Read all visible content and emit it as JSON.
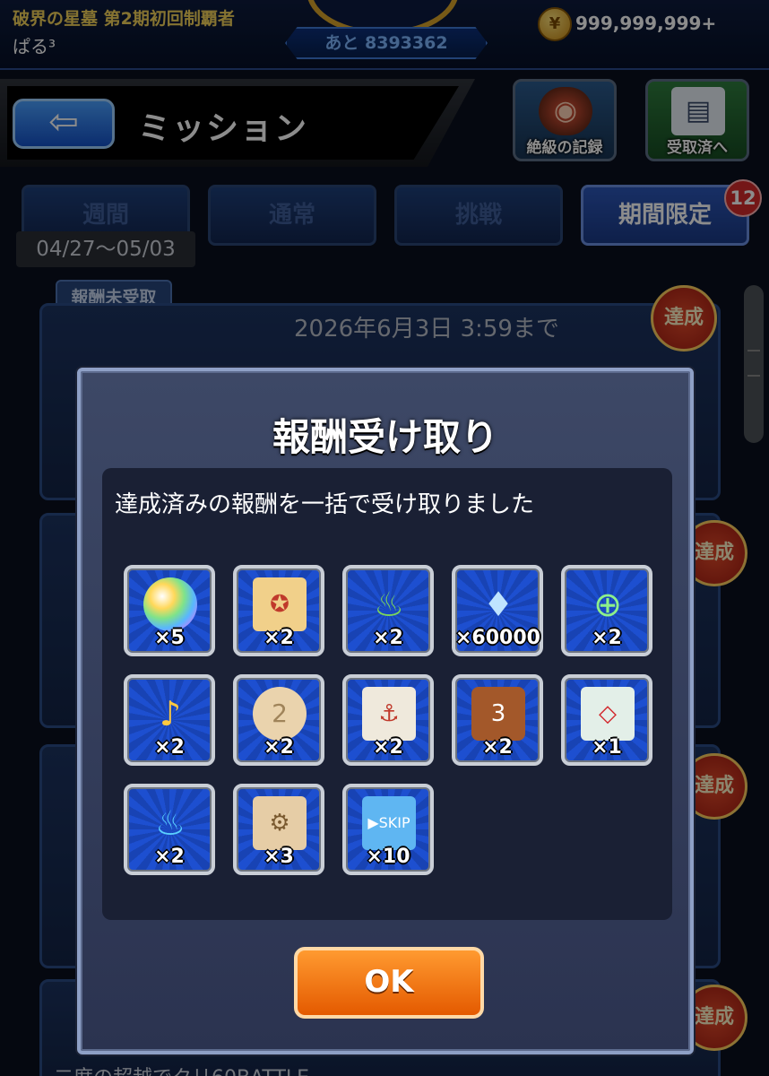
{
  "header": {
    "title": "破界の星墓 第2期初回制覇者",
    "player_name": "ぱる³",
    "remaining": "あと 8393362",
    "coin_count": "999,999,999+"
  },
  "mission": {
    "back_label": "⇦",
    "title": "ミッション",
    "record_label": "絶級の記録",
    "received_label": "受取済へ"
  },
  "tabs": [
    {
      "label": "週間"
    },
    {
      "label": "通常"
    },
    {
      "label": "挑戦"
    },
    {
      "label": "期間限定"
    }
  ],
  "tab_badge": "12",
  "date_range": "04/27〜05/03",
  "list": {
    "unreceived_tag": "報酬未受取",
    "deadline": "2026年6月3日 3:59まで",
    "stamp": "達成",
    "bottom_text": "二度の超越でクリ60BATTLE..."
  },
  "dialog": {
    "title": "報酬受け取り",
    "message": "達成済みの報酬を一括で受け取りました",
    "ok_label": "OK",
    "rewards": [
      {
        "icon": "rainbow-orb",
        "qty": "×5"
      },
      {
        "icon": "scroll-red",
        "qty": "×2"
      },
      {
        "icon": "potion-green",
        "qty": "×2"
      },
      {
        "icon": "blue-flame",
        "qty": "×60000"
      },
      {
        "icon": "magnifier",
        "qty": "×2"
      },
      {
        "icon": "bell",
        "qty": "×2"
      },
      {
        "icon": "cookie-medal",
        "qty": "×2"
      },
      {
        "icon": "scroll-red-2",
        "qty": "×2"
      },
      {
        "icon": "dice",
        "qty": "×2"
      },
      {
        "icon": "scroll-map",
        "qty": "×1"
      },
      {
        "icon": "el-potion",
        "qty": "×2"
      },
      {
        "icon": "ticket",
        "qty": "×3"
      },
      {
        "icon": "skip-ticket",
        "qty": "×10"
      }
    ]
  }
}
